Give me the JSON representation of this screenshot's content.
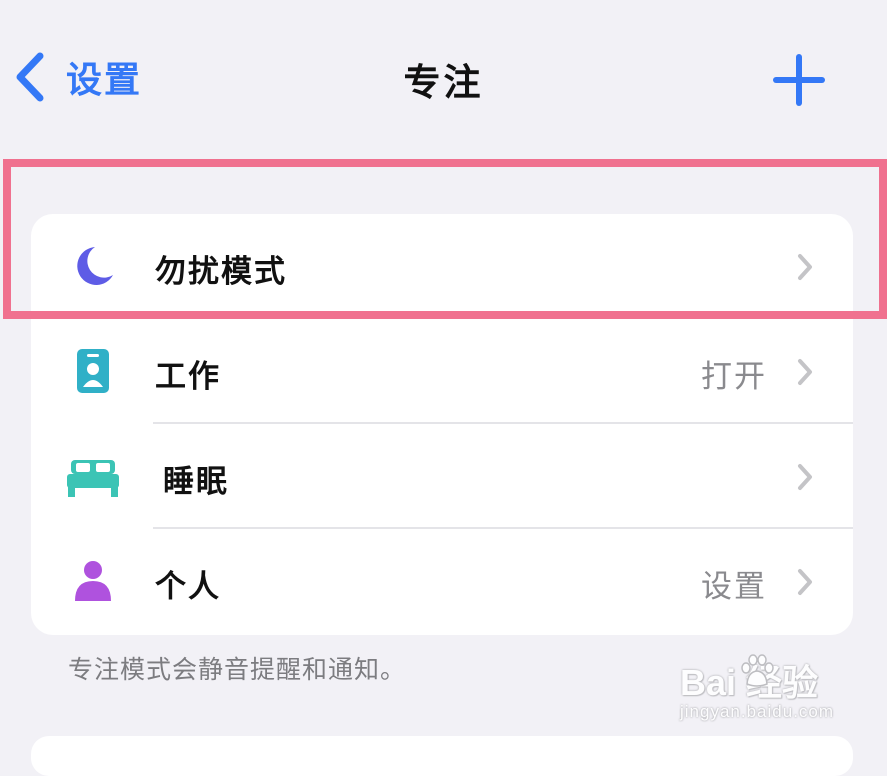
{
  "nav": {
    "back_label": "设置",
    "title": "专注",
    "add_icon": "plus-icon",
    "back_icon": "chevron-left-icon"
  },
  "focus_list": {
    "items": [
      {
        "label": "勿扰模式",
        "value": "",
        "icon": "moon-icon",
        "icon_color": "#5e5ce6"
      },
      {
        "label": "工作",
        "value": "打开",
        "icon": "id-badge-icon",
        "icon_color": "#30b0c7"
      },
      {
        "label": "睡眠",
        "value": "",
        "icon": "bed-icon",
        "icon_color": "#3bc4b5"
      },
      {
        "label": "个人",
        "value": "设置",
        "icon": "person-icon",
        "icon_color": "#af52de"
      }
    ],
    "footer": "专注模式会静音提醒和通知。"
  },
  "colors": {
    "accent": "#3478f6",
    "background": "#f2f1f6",
    "highlight": "#f0718f"
  },
  "watermark": {
    "brand": "Bai  经验",
    "site": "jingyan.baidu.com"
  }
}
